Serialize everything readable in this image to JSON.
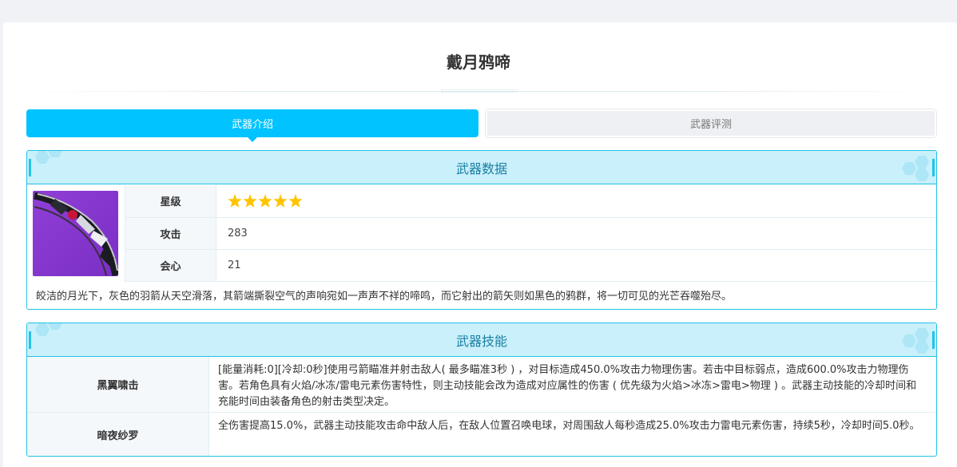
{
  "page": {
    "title": "戴月鸦啼"
  },
  "tabs": [
    {
      "label": "武器介绍",
      "active": true
    },
    {
      "label": "武器评测",
      "active": false
    }
  ],
  "weapon_data": {
    "heading": "武器数据",
    "stats": [
      {
        "key": "星级",
        "value": "",
        "stars": 5
      },
      {
        "key": "攻击",
        "value": "283"
      },
      {
        "key": "会心",
        "value": "21"
      }
    ],
    "description": "皎洁的月光下，灰色的羽箭从天空滑落，其箭端撕裂空气的声响宛如一声声不祥的啼鸣，而它射出的箭矢则如黑色的鸦群，将一切可见的光芒吞噬殆尽。"
  },
  "weapon_skills": {
    "heading": "武器技能",
    "items": [
      {
        "name": "黑翼啸击",
        "desc": "[能量消耗:0][冷却:0秒]使用弓箭瞄准并射击敌人( 最多瞄准3秒 ) ，对目标造成450.0%攻击力物理伤害。若击中目标弱点，造成600.0%攻击力物理伤害。若角色具有火焰/冰冻/雷电元素伤害特性，则主动技能会改为造成对应属性的伤害 ( 优先级为火焰>冰冻>雷电>物理 ) 。武器主动技能的冷却时间和充能时间由装备角色的射击类型决定。"
      },
      {
        "name": "暗夜纱罗",
        "desc": "全伤害提高15.0%，武器主动技能攻击命中敌人后，在敌人位置召唤电球，对周围敌人每秒造成25.0%攻击力雷电元素伤害，持续5秒，冷却时间5.0秒。"
      }
    ]
  },
  "colors": {
    "accent": "#00c3ff",
    "panel_border": "#22c3e6",
    "panel_head_bg": "#c9f0fb",
    "panel_head_text": "#1a7fa3",
    "star": "#ffc400",
    "weapon_bg": "#8f3fd6"
  },
  "icons": {
    "weapon": "bow-weapon-image",
    "rating": "star-icon"
  }
}
